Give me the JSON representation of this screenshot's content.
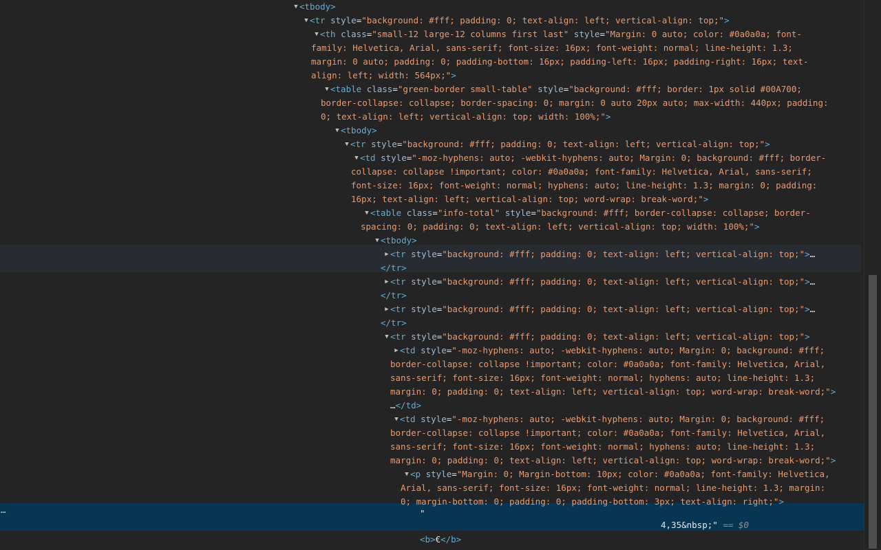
{
  "elements_tree": {
    "lines": [
      {
        "arrow": "▼",
        "segs": [
          [
            "tag",
            "<tbody>"
          ]
        ]
      },
      {
        "arrow": "▼",
        "segs": [
          [
            "tag",
            "<tr"
          ],
          [
            "text",
            " "
          ],
          [
            "attr",
            "style"
          ],
          [
            "text",
            "="
          ],
          [
            "val",
            "\"background: #fff; padding: 0; text-align: left; vertical-align: top;\""
          ],
          [
            "tag",
            ">"
          ]
        ]
      },
      {
        "arrow": "▼",
        "segs": [
          [
            "tag",
            "<th"
          ],
          [
            "text",
            " "
          ],
          [
            "attr",
            "class"
          ],
          [
            "text",
            "="
          ],
          [
            "val",
            "\"small-12 large-12 columns first last\""
          ],
          [
            "text",
            " "
          ],
          [
            "attr",
            "style"
          ],
          [
            "text",
            "="
          ],
          [
            "val",
            "\"Margin: 0 auto; color: #0a0a0a; font-"
          ]
        ]
      },
      {
        "arrow": "",
        "segs": [
          [
            "val",
            "family: Helvetica, Arial, sans-serif; font-size: 16px; font-weight: normal; line-height: 1.3;"
          ]
        ]
      },
      {
        "arrow": "",
        "segs": [
          [
            "val",
            "margin: 0 auto; padding: 0; padding-bottom: 16px; padding-left: 16px; padding-right: 16px; text-"
          ]
        ]
      },
      {
        "arrow": "",
        "segs": [
          [
            "val",
            "align: left; width: 564px;\""
          ],
          [
            "tag",
            ">"
          ]
        ]
      },
      {
        "arrow": "▼",
        "segs": [
          [
            "tag",
            "<table"
          ],
          [
            "text",
            " "
          ],
          [
            "attr",
            "class"
          ],
          [
            "text",
            "="
          ],
          [
            "val",
            "\"green-border small-table\""
          ],
          [
            "text",
            " "
          ],
          [
            "attr",
            "style"
          ],
          [
            "text",
            "="
          ],
          [
            "val",
            "\"background: #fff; border: 1px solid #00A700;"
          ]
        ]
      },
      {
        "arrow": "",
        "segs": [
          [
            "val",
            "border-collapse: collapse; border-spacing: 0; margin: 0 auto 20px auto; max-width: 440px; padding:"
          ]
        ]
      },
      {
        "arrow": "",
        "segs": [
          [
            "val",
            "0; text-align: left; vertical-align: top; width: 100%;\""
          ],
          [
            "tag",
            ">"
          ]
        ]
      },
      {
        "arrow": "▼",
        "segs": [
          [
            "tag",
            "<tbody>"
          ]
        ]
      },
      {
        "arrow": "▼",
        "segs": [
          [
            "tag",
            "<tr"
          ],
          [
            "text",
            " "
          ],
          [
            "attr",
            "style"
          ],
          [
            "text",
            "="
          ],
          [
            "val",
            "\"background: #fff; padding: 0; text-align: left; vertical-align: top;\""
          ],
          [
            "tag",
            ">"
          ]
        ]
      },
      {
        "arrow": "▼",
        "segs": [
          [
            "tag",
            "<td"
          ],
          [
            "text",
            " "
          ],
          [
            "attr",
            "style"
          ],
          [
            "text",
            "="
          ],
          [
            "val",
            "\"-moz-hyphens: auto; -webkit-hyphens: auto; Margin: 0; background: #fff; border-"
          ]
        ]
      },
      {
        "arrow": "",
        "segs": [
          [
            "val",
            "collapse: collapse !important; color: #0a0a0a; font-family: Helvetica, Arial, sans-serif;"
          ]
        ]
      },
      {
        "arrow": "",
        "segs": [
          [
            "val",
            "font-size: 16px; font-weight: normal; hyphens: auto; line-height: 1.3; margin: 0; padding:"
          ]
        ]
      },
      {
        "arrow": "",
        "segs": [
          [
            "val",
            "16px; text-align: left; vertical-align: top; word-wrap: break-word;\""
          ],
          [
            "tag",
            ">"
          ]
        ]
      },
      {
        "arrow": "▼",
        "segs": [
          [
            "tag",
            "<table"
          ],
          [
            "text",
            " "
          ],
          [
            "attr",
            "class"
          ],
          [
            "text",
            "="
          ],
          [
            "val",
            "\"info-total\""
          ],
          [
            "text",
            " "
          ],
          [
            "attr",
            "style"
          ],
          [
            "text",
            "="
          ],
          [
            "val",
            "\"background: #fff; border-collapse: collapse; border-"
          ]
        ]
      },
      {
        "arrow": "",
        "segs": [
          [
            "val",
            "spacing: 0; padding: 0; text-align: left; vertical-align: top; width: 100%;\""
          ],
          [
            "tag",
            ">"
          ]
        ]
      },
      {
        "arrow": "▼",
        "segs": [
          [
            "tag",
            "<tbody>"
          ]
        ]
      },
      {
        "arrow": "▶",
        "segs": [
          [
            "tag",
            "<tr"
          ],
          [
            "text",
            " "
          ],
          [
            "attr",
            "style"
          ],
          [
            "text",
            "="
          ],
          [
            "val",
            "\"background: #fff; padding: 0; text-align: left; vertical-align: top;\""
          ],
          [
            "tag",
            ">"
          ],
          [
            "text",
            "…"
          ]
        ]
      },
      {
        "arrow": "",
        "segs": [
          [
            "tag",
            "</tr>"
          ]
        ]
      },
      {
        "arrow": "▶",
        "segs": [
          [
            "tag",
            "<tr"
          ],
          [
            "text",
            " "
          ],
          [
            "attr",
            "style"
          ],
          [
            "text",
            "="
          ],
          [
            "val",
            "\"background: #fff; padding: 0; text-align: left; vertical-align: top;\""
          ],
          [
            "tag",
            ">"
          ],
          [
            "text",
            "…"
          ]
        ]
      },
      {
        "arrow": "",
        "segs": [
          [
            "tag",
            "</tr>"
          ]
        ]
      },
      {
        "arrow": "▶",
        "segs": [
          [
            "tag",
            "<tr"
          ],
          [
            "text",
            " "
          ],
          [
            "attr",
            "style"
          ],
          [
            "text",
            "="
          ],
          [
            "val",
            "\"background: #fff; padding: 0; text-align: left; vertical-align: top;\""
          ],
          [
            "tag",
            ">"
          ],
          [
            "text",
            "…"
          ]
        ]
      },
      {
        "arrow": "",
        "segs": [
          [
            "tag",
            "</tr>"
          ]
        ]
      },
      {
        "arrow": "▼",
        "segs": [
          [
            "tag",
            "<tr"
          ],
          [
            "text",
            " "
          ],
          [
            "attr",
            "style"
          ],
          [
            "text",
            "="
          ],
          [
            "val",
            "\"background: #fff; padding: 0; text-align: left; vertical-align: top;\""
          ],
          [
            "tag",
            ">"
          ]
        ]
      },
      {
        "arrow": "▶",
        "segs": [
          [
            "tag",
            "<td"
          ],
          [
            "text",
            " "
          ],
          [
            "attr",
            "style"
          ],
          [
            "text",
            "="
          ],
          [
            "val",
            "\"-moz-hyphens: auto; -webkit-hyphens: auto; Margin: 0; background: #fff;"
          ]
        ]
      },
      {
        "arrow": "",
        "segs": [
          [
            "val",
            "border-collapse: collapse !important; color: #0a0a0a; font-family: Helvetica, Arial,"
          ]
        ]
      },
      {
        "arrow": "",
        "segs": [
          [
            "val",
            "sans-serif; font-size: 16px; font-weight: normal; hyphens: auto; line-height: 1.3;"
          ]
        ]
      },
      {
        "arrow": "",
        "segs": [
          [
            "val",
            "margin: 0; padding: 0; text-align: left; vertical-align: top; word-wrap: break-word;\""
          ],
          [
            "tag",
            ">"
          ]
        ]
      },
      {
        "arrow": "",
        "segs": [
          [
            "text",
            "…"
          ],
          [
            "tag",
            "</td>"
          ]
        ]
      },
      {
        "arrow": "▼",
        "segs": [
          [
            "tag",
            "<td"
          ],
          [
            "text",
            " "
          ],
          [
            "attr",
            "style"
          ],
          [
            "text",
            "="
          ],
          [
            "val",
            "\"-moz-hyphens: auto; -webkit-hyphens: auto; Margin: 0; background: #fff;"
          ]
        ]
      },
      {
        "arrow": "",
        "segs": [
          [
            "val",
            "border-collapse: collapse !important; color: #0a0a0a; font-family: Helvetica, Arial,"
          ]
        ]
      },
      {
        "arrow": "",
        "segs": [
          [
            "val",
            "sans-serif; font-size: 16px; font-weight: normal; hyphens: auto; line-height: 1.3;"
          ]
        ]
      },
      {
        "arrow": "",
        "segs": [
          [
            "val",
            "margin: 0; padding: 0; text-align: left; vertical-align: top; word-wrap: break-word;\""
          ],
          [
            "tag",
            ">"
          ]
        ]
      },
      {
        "arrow": "▼",
        "segs": [
          [
            "tag",
            "<p"
          ],
          [
            "text",
            " "
          ],
          [
            "attr",
            "style"
          ],
          [
            "text",
            "="
          ],
          [
            "val",
            "\"Margin: 0; Margin-bottom: 10px; color: #0a0a0a; font-family: Helvetica,"
          ]
        ]
      },
      {
        "arrow": "",
        "segs": [
          [
            "val",
            "Arial, sans-serif; font-size: 16px; font-weight: normal; line-height: 1.3; margin:"
          ]
        ]
      },
      {
        "arrow": "",
        "segs": [
          [
            "val",
            "0; margin-bottom: 0; padding: 0; padding-bottom: 3px; text-align: right;\""
          ],
          [
            "tag",
            ">"
          ]
        ]
      },
      {
        "arrow": "",
        "segs": [
          [
            "text",
            "\""
          ]
        ]
      },
      {
        "arrow": "",
        "segs": [
          [
            "text",
            "4,35&nbsp;\""
          ],
          [
            "text",
            " "
          ],
          [
            "eq",
            "== $0"
          ]
        ]
      },
      {
        "arrow": "",
        "segs": [
          [
            "tag",
            "<b>"
          ],
          [
            "text",
            "€"
          ],
          [
            "tag",
            "</b>"
          ]
        ]
      }
    ],
    "selected_prefix": "…",
    "colors": {
      "background": "#242424",
      "tag": "#5db0d7",
      "attr": "#9bbbdc",
      "value": "#f29766",
      "selected": "#073655",
      "hover": "#272c33"
    }
  }
}
